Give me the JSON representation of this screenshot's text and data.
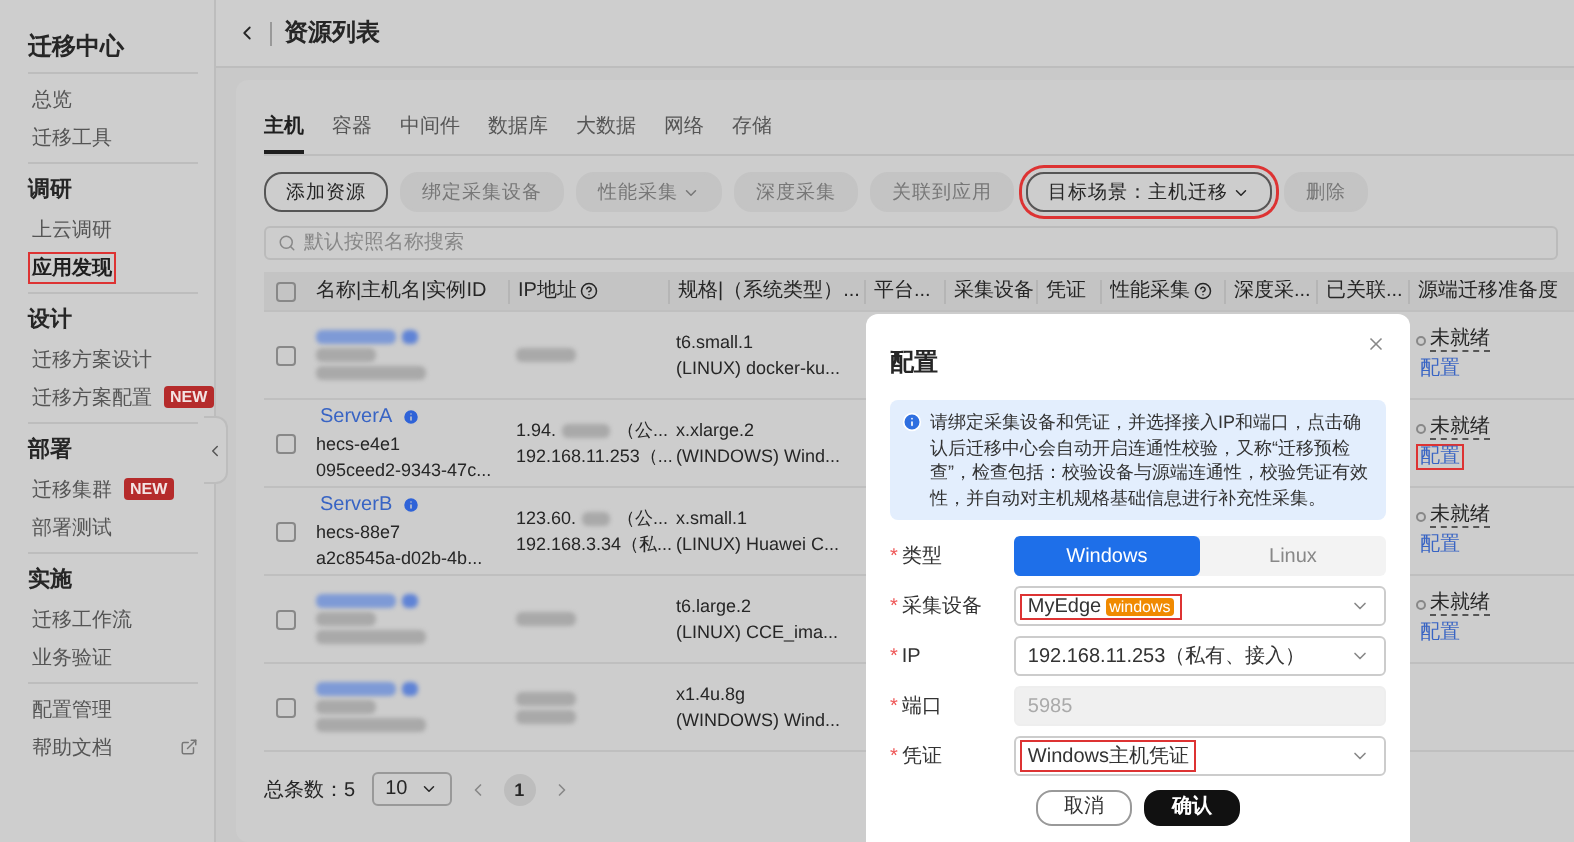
{
  "sidebar": {
    "title": "迁移中心",
    "groups": [
      {
        "items": [
          {
            "label": "总览",
            "selected": false,
            "highlighted": false
          },
          {
            "label": "迁移工具",
            "selected": false,
            "highlighted": false
          }
        ]
      },
      {
        "heading": "调研",
        "items": [
          {
            "label": "上云调研",
            "selected": false,
            "highlighted": false
          },
          {
            "label": "应用发现",
            "selected": true,
            "highlighted": true
          }
        ]
      },
      {
        "heading": "设计",
        "items": [
          {
            "label": "迁移方案设计",
            "selected": false,
            "highlighted": false
          },
          {
            "label": "迁移方案配置",
            "badge": "NEW",
            "selected": false,
            "highlighted": false
          }
        ]
      },
      {
        "heading": "部署",
        "items": [
          {
            "label": "迁移集群",
            "badge": "NEW",
            "selected": false,
            "highlighted": false
          },
          {
            "label": "部署测试",
            "selected": false,
            "highlighted": false
          }
        ]
      },
      {
        "heading": "实施",
        "items": [
          {
            "label": "迁移工作流",
            "selected": false,
            "highlighted": false
          },
          {
            "label": "业务验证",
            "selected": false,
            "highlighted": false
          }
        ]
      },
      {
        "items": [
          {
            "label": "配置管理",
            "selected": false,
            "highlighted": false
          },
          {
            "label": "帮助文档",
            "external": true,
            "selected": false,
            "highlighted": false
          }
        ]
      }
    ]
  },
  "header": {
    "title": "资源列表"
  },
  "tabs": [
    {
      "label": "主机",
      "selected": true
    },
    {
      "label": "容器",
      "selected": false
    },
    {
      "label": "中间件",
      "selected": false
    },
    {
      "label": "数据库",
      "selected": false
    },
    {
      "label": "大数据",
      "selected": false
    },
    {
      "label": "网络",
      "selected": false
    },
    {
      "label": "存储",
      "selected": false
    }
  ],
  "toolbar": [
    {
      "label": "添加资源",
      "disabled": false,
      "dropdown": false,
      "highlighted": false
    },
    {
      "label": "绑定采集设备",
      "disabled": true,
      "dropdown": false,
      "highlighted": false
    },
    {
      "label": "性能采集",
      "disabled": true,
      "dropdown": true,
      "highlighted": false
    },
    {
      "label": "深度采集",
      "disabled": true,
      "dropdown": false,
      "highlighted": false
    },
    {
      "label": "关联到应用",
      "disabled": true,
      "dropdown": false,
      "highlighted": false
    },
    {
      "label": "目标场景：主机迁移",
      "disabled": false,
      "dropdown": true,
      "highlighted": true
    },
    {
      "label": "删除",
      "disabled": true,
      "dropdown": false,
      "highlighted": false
    }
  ],
  "search": {
    "placeholder": "默认按照名称搜索"
  },
  "table": {
    "select_all": {
      "checked": false
    },
    "columns": [
      {
        "label": "名称|主机名|实例ID",
        "help": false
      },
      {
        "label": "IP地址",
        "help": true
      },
      {
        "label": "规格|（系统类型）...",
        "help": false
      },
      {
        "label": "平台...",
        "help": false
      },
      {
        "label": "采集设备",
        "help": false
      },
      {
        "label": "凭证",
        "help": false
      },
      {
        "label": "性能采集",
        "help": true
      },
      {
        "label": "深度采...",
        "help": false
      },
      {
        "label": "已关联...",
        "help": false
      },
      {
        "label": "源端迁移准备度",
        "help": false
      }
    ],
    "rows": [
      {
        "checked": false,
        "redacted": true,
        "ip": [
          [
            {
              "kind": "redacted"
            }
          ]
        ],
        "spec": [
          "t6.small.1",
          "(LINUX) docker-ku..."
        ],
        "readiness": {
          "status": "未就绪",
          "action": "配置",
          "highlighted": false
        }
      },
      {
        "checked": false,
        "redacted": false,
        "name": "ServerA",
        "hostname": "hecs-e4e1",
        "id": "095ceed2-9343-47c...",
        "ip": [
          [
            {
              "kind": "text",
              "text": "1.94."
            },
            {
              "kind": "redacted"
            },
            {
              "kind": "text",
              "text": "（公..."
            }
          ],
          [
            {
              "kind": "text",
              "text": "192.168.11.253（..."
            }
          ]
        ],
        "spec": [
          "x.xlarge.2",
          "(WINDOWS) Wind..."
        ],
        "readiness": {
          "status": "未就绪",
          "action": "配置",
          "highlighted": true
        }
      },
      {
        "checked": false,
        "redacted": false,
        "name": "ServerB",
        "hostname": "hecs-88e7",
        "id": "a2c8545a-d02b-4b...",
        "ip": [
          [
            {
              "kind": "text",
              "text": "123.60."
            },
            {
              "kind": "redacted"
            },
            {
              "kind": "text",
              "text": "（公..."
            }
          ],
          [
            {
              "kind": "text",
              "text": "192.168.3.34（私..."
            }
          ]
        ],
        "spec": [
          "x.small.1",
          "(LINUX) Huawei C..."
        ],
        "readiness": {
          "status": "未就绪",
          "action": "配置",
          "highlighted": false
        }
      },
      {
        "checked": false,
        "redacted": true,
        "ip": [
          [
            {
              "kind": "redacted"
            }
          ]
        ],
        "spec": [
          "t6.large.2",
          "(LINUX) CCE_ima..."
        ],
        "readiness": {
          "status": "未就绪",
          "action": "配置",
          "highlighted": false
        }
      },
      {
        "checked": false,
        "redacted": true,
        "ip": [
          [
            {
              "kind": "redacted"
            }
          ],
          [
            {
              "kind": "redacted"
            }
          ]
        ],
        "spec": [
          "x1.4u.8g",
          "(WINDOWS) Wind..."
        ]
      }
    ]
  },
  "pagination": {
    "total": "总条数：5",
    "page_size": "10",
    "pages": [
      {
        "label": "1",
        "selected": true
      }
    ]
  },
  "dialog": {
    "title": "配置",
    "info": "请绑定采集设备和凭证，并选择接入IP和端口，点击确认后迁移中心会自动开启连通性校验，又称“迁移预检查”，检查包括：校验设备与源端连通性，校验凭证有效性，并自动对主机规格基础信息进行补充性采集。",
    "fields": [
      {
        "label": "类型",
        "required": "*",
        "kind": "segmented",
        "options": [
          {
            "label": "Windows",
            "selected": true
          },
          {
            "label": "Linux",
            "selected": false
          }
        ]
      },
      {
        "label": "采集设备",
        "required": "*",
        "kind": "select",
        "value": "MyEdge",
        "tag": "windows",
        "highlighted": true,
        "disabled": false
      },
      {
        "label": "IP",
        "required": "*",
        "kind": "select",
        "value": "192.168.11.253（私有、接入）",
        "highlighted": false,
        "disabled": false
      },
      {
        "label": "端口",
        "required": "*",
        "kind": "input",
        "value": "5985",
        "highlighted": false,
        "disabled": true
      },
      {
        "label": "凭证",
        "required": "*",
        "kind": "select",
        "value": "Windows主机凭证",
        "highlighted": true,
        "disabled": false
      }
    ],
    "buttons": [
      {
        "label": "取消",
        "kind": "secondary"
      },
      {
        "label": "确认",
        "kind": "primary"
      }
    ]
  }
}
